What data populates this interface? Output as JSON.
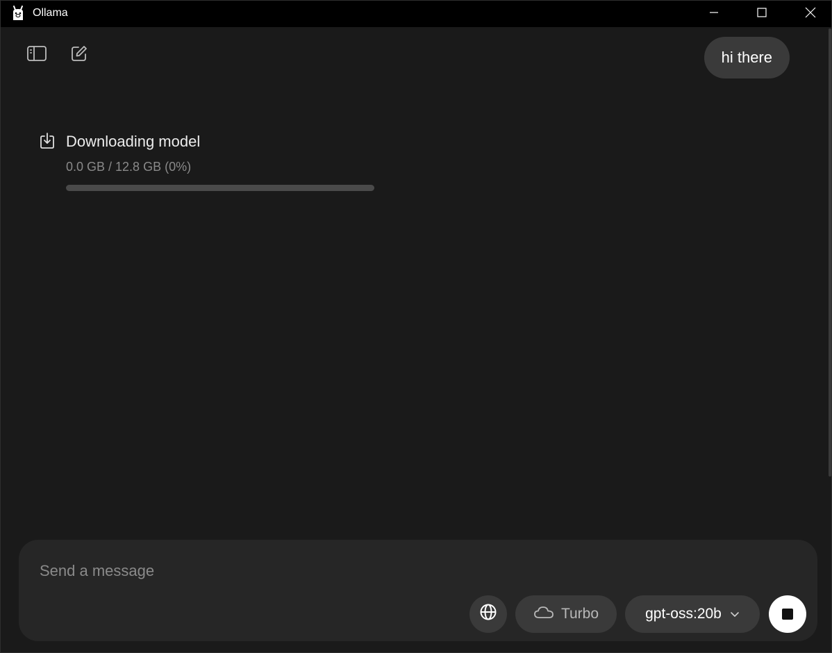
{
  "window": {
    "title": "Ollama",
    "icons": {
      "app": "ollama-llama-icon",
      "minimize": "minimize-icon",
      "maximize": "maximize-icon",
      "close": "close-icon"
    }
  },
  "toolbar": {
    "sidebar_icon": "sidebar-toggle-icon",
    "new_chat_icon": "new-chat-icon"
  },
  "chat": {
    "user_message": "hi there"
  },
  "download": {
    "icon": "download-icon",
    "title": "Downloading model",
    "status": "0.0 GB / 12.8 GB (0%)",
    "progress_percent": 0
  },
  "composer": {
    "placeholder": "Send a message",
    "value": "",
    "web_search_icon": "globe-icon",
    "turbo_label": "Turbo",
    "turbo_icon": "cloud-icon",
    "model_label": "gpt-oss:20b",
    "model_icon": "chevron-down-icon",
    "stop_icon": "stop-icon"
  },
  "colors": {
    "background": "#1a1a1a",
    "titlebar": "#000000",
    "bubble": "#3a3a3a",
    "composer": "#262626",
    "muted_text": "#8a8a8a"
  }
}
